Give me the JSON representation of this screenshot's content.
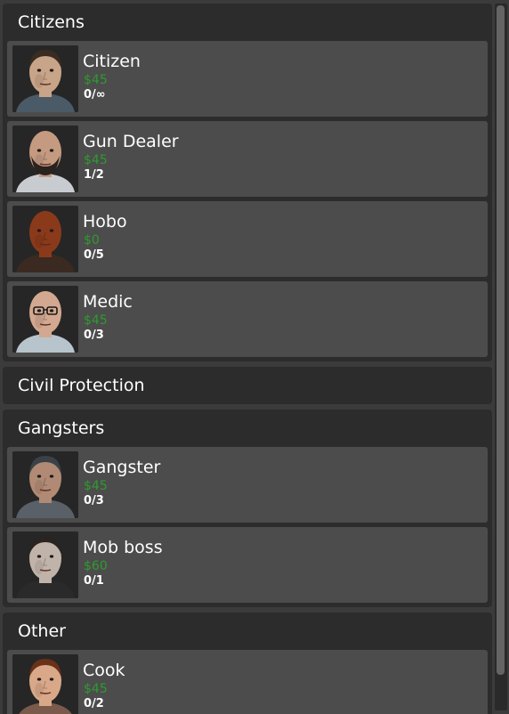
{
  "categories": [
    {
      "name": "Citizens",
      "jobs": [
        {
          "name": "Citizen",
          "price": "$45",
          "slots": "0/∞",
          "skin": "#c8a488",
          "hair": "#3a2c22",
          "beard": "",
          "shirt": "#4a5a66",
          "glasses": false
        },
        {
          "name": "Gun Dealer",
          "price": "$45",
          "slots": "1/2",
          "skin": "#c49a80",
          "hair": "",
          "beard": "#2a221e",
          "shirt": "#c8ccd0",
          "glasses": false
        },
        {
          "name": "Hobo",
          "price": "$0",
          "slots": "0/5",
          "skin": "#8a3a1a",
          "hair": "",
          "beard": "",
          "shirt": "#3a2a22",
          "glasses": false
        },
        {
          "name": "Medic",
          "price": "$45",
          "slots": "0/3",
          "skin": "#d2a890",
          "hair": "",
          "beard": "",
          "shirt": "#b8c4cc",
          "glasses": true
        }
      ]
    },
    {
      "name": "Civil Protection",
      "jobs": []
    },
    {
      "name": "Gangsters",
      "jobs": [
        {
          "name": "Gangster",
          "price": "$45",
          "slots": "0/3",
          "skin": "#b08a74",
          "hair": "#3a4248",
          "beard": "",
          "shirt": "#5a6068",
          "glasses": false
        },
        {
          "name": "Mob boss",
          "price": "$60",
          "slots": "0/1",
          "skin": "#c0b4aa",
          "hair": "#2a2420",
          "beard": "",
          "shirt": "#2a2a2a",
          "glasses": false
        }
      ]
    },
    {
      "name": "Other",
      "jobs": [
        {
          "name": "Cook",
          "price": "$45",
          "slots": "0/2",
          "skin": "#d8a888",
          "hair": "#6a3018",
          "beard": "",
          "shirt": "#7a5a4a",
          "glasses": false
        }
      ]
    }
  ],
  "scrollbar": {
    "position": 0
  }
}
